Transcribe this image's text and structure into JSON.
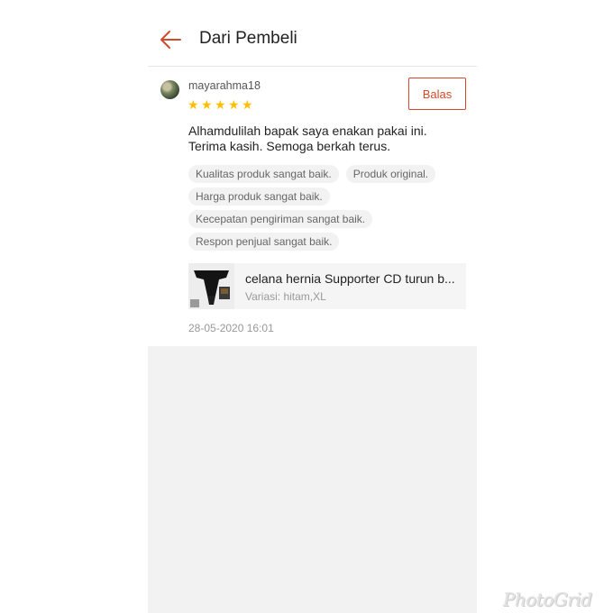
{
  "header": {
    "title": "Dari Pembeli",
    "back_icon": "arrow-left-icon",
    "accent_color": "#d24a2a"
  },
  "review": {
    "username": "mayarahma18",
    "rating": 5,
    "rating_max": 5,
    "star_color": "#ffbf00",
    "reply_label": "Balas",
    "comment_line1": "Alhamdulilah bapak saya enakan pakai ini.",
    "comment_line2": "Terima kasih. Semoga berkah terus.",
    "tags": [
      "Kualitas produk sangat baik.",
      "Produk original.",
      "Harga produk sangat baik.",
      "Kecepatan pengiriman sangat baik.",
      "Respon penjual sangat baik."
    ],
    "product": {
      "name": "celana hernia Supporter CD turun b...",
      "variant": "Variasi: hitam,XL"
    },
    "timestamp": "28-05-2020 16:01"
  },
  "watermark": "PhotoGrid"
}
